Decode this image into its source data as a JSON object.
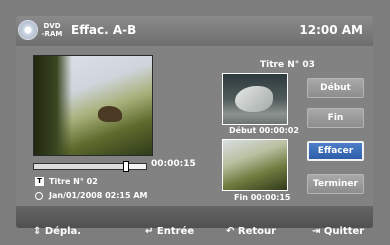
{
  "header": {
    "disc_type_line1": "DVD",
    "disc_type_line2": "-RAM",
    "title": "Effac. A-B",
    "clock": "12:00 AM"
  },
  "playback": {
    "progress_fraction": 0.82,
    "current_time": "00:00:15",
    "title_badge": "T",
    "title_number": "Titre N° 02",
    "date": "Jan/01/2008  02:15 AM"
  },
  "side_panel": {
    "title_label": "Titre N° 03",
    "start_caption": "Début  00:00:02",
    "end_caption": "Fin 00:00:15"
  },
  "buttons": [
    {
      "label": "Début",
      "selected": false
    },
    {
      "label": "Fin",
      "selected": false
    },
    {
      "label": "Effacer",
      "selected": true
    },
    {
      "label": "Terminer",
      "selected": false
    }
  ],
  "footer": {
    "move": "Dépla.",
    "enter": "Entrée",
    "back": "Retour",
    "exit": "Quitter"
  },
  "icons": {
    "move": "up-down-arrows-icon",
    "enter": "enter-icon",
    "back": "return-arrow-icon",
    "exit": "exit-icon",
    "disc": "disc-icon",
    "clock": "clock-icon"
  },
  "colors": {
    "background": "#7d7d7d",
    "selected_button": "#2e5ea9"
  }
}
